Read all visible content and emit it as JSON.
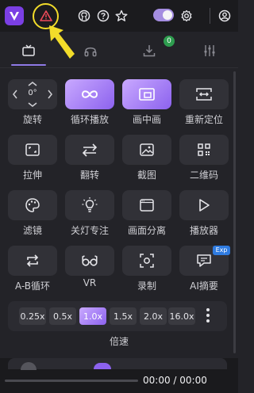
{
  "topbar": {
    "logo_letter": "V",
    "icons": [
      "logo-icon",
      "warning-icon",
      "github-icon",
      "help-icon",
      "star-icon",
      "theme-toggle",
      "gear-icon",
      "account-icon"
    ],
    "highlight_color": "#f2dc2a"
  },
  "tabs": {
    "items": [
      {
        "name": "tv-icon",
        "active": true
      },
      {
        "name": "headphones-icon",
        "active": false
      },
      {
        "name": "download-icon",
        "active": false,
        "badge": "0"
      },
      {
        "name": "equalizer-icon",
        "active": false
      }
    ]
  },
  "tools": [
    {
      "label": "旋转",
      "icon": "rotate-icon",
      "value": "0°"
    },
    {
      "label": "循环播放",
      "icon": "loop-icon",
      "active": true
    },
    {
      "label": "画中画",
      "icon": "pip-icon",
      "active": true
    },
    {
      "label": "重新定位",
      "icon": "reposition-icon"
    },
    {
      "label": "拉伸",
      "icon": "stretch-icon"
    },
    {
      "label": "翻转",
      "icon": "flip-icon"
    },
    {
      "label": "截图",
      "icon": "screenshot-icon"
    },
    {
      "label": "二维码",
      "icon": "qrcode-icon"
    },
    {
      "label": "滤镜",
      "icon": "palette-icon"
    },
    {
      "label": "关灯专注",
      "icon": "bulb-icon"
    },
    {
      "label": "画面分离",
      "icon": "window-icon"
    },
    {
      "label": "播放器",
      "icon": "play-icon"
    },
    {
      "label": "A-B循环",
      "icon": "ab-loop-icon"
    },
    {
      "label": "VR",
      "icon": "vr-glasses-icon"
    },
    {
      "label": "录制",
      "icon": "record-icon"
    },
    {
      "label": "AI摘要",
      "icon": "ai-summary-icon",
      "tag": "Exp"
    }
  ],
  "speed": {
    "options": [
      "0.25x",
      "0.5x",
      "1.0x",
      "1.5x",
      "2.0x",
      "16.0x"
    ],
    "selected": "1.0x",
    "label": "倍速"
  },
  "player": {
    "time": "00:00 / 00:00"
  },
  "colors": {
    "accent": "#8c62ee",
    "accent_light": "#c9a9ff",
    "background": "#232328",
    "tile": "#313137"
  }
}
